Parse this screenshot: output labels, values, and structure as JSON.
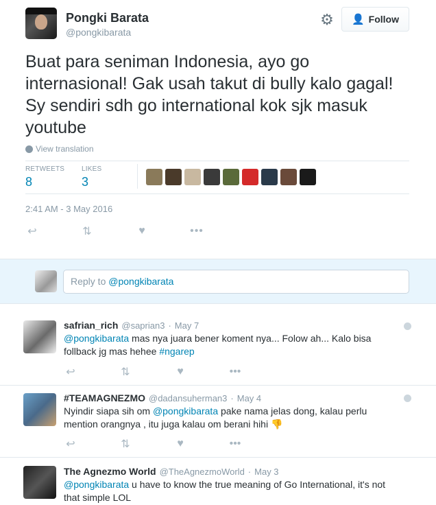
{
  "tweet": {
    "author_name": "Pongki Barata",
    "author_handle": "@pongkibarata",
    "follow_label": "Follow",
    "text": "Buat para seniman Indonesia, ayo go internasional! Gak usah takut di bully kalo gagal! Sy sendiri sdh go international kok sjk masuk youtube",
    "view_translation": "View translation",
    "retweets_label": "RETWEETS",
    "retweets_count": "8",
    "likes_label": "LIKES",
    "likes_count": "3",
    "timestamp": "2:41 AM - 3 May 2016"
  },
  "likers_thumbnail_colors": [
    "#8a7a5a",
    "#4a3a2a",
    "#c8b8a0",
    "#3a3a3a",
    "#5a6a3a",
    "#d42a2a",
    "#2a3a4a",
    "#6a4a3a",
    "#1a1a1a"
  ],
  "reply_box": {
    "placeholder_prefix": "Reply to ",
    "placeholder_handle": "@pongkibarata"
  },
  "replies": [
    {
      "name": "safrian_rich",
      "handle": "@saprian3",
      "date": "May 7",
      "text_mention": "@pongkibarata",
      "text_body": " mas nya juara bener koment nya... Folow ah... Kalo bisa follback jg mas hehee ",
      "text_hashtag": "#ngarep"
    },
    {
      "name": "#TEAMAGNEZMO",
      "handle": "@dadansuherman3",
      "date": "May 4",
      "text_start": "Nyindir siapa sih om ",
      "text_mention": "@pongkibarata",
      "text_body": "  pake nama jelas dong, kalau perlu mention orangnya , itu juga kalau om berani hihi ",
      "emoji": "👎"
    },
    {
      "name": "The Agnezmo World",
      "handle": "@TheAgnezmoWorld",
      "date": "May 3",
      "text_mention": "@pongkibarata",
      "text_body": " u have to know the true meaning of Go International, it's not that simple LOL"
    }
  ],
  "icons": {
    "reply": "reply-icon",
    "retweet": "retweet-icon",
    "like": "heart-icon",
    "more": "more-icon"
  }
}
